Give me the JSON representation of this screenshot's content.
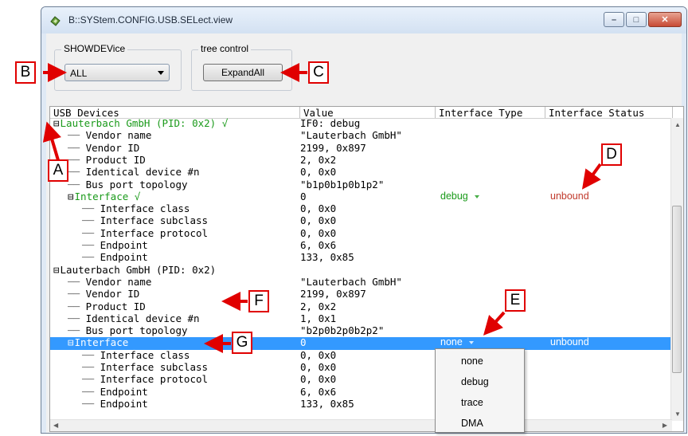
{
  "window": {
    "title": "B::SYStem.CONFIG.USB.SELect.view"
  },
  "controls": {
    "showdevice_label": "SHOWDEVice",
    "showdevice_value": "ALL",
    "tree_control_label": "tree control",
    "expand_button": "ExpandAll"
  },
  "table": {
    "columns": [
      "USB Devices",
      "Value",
      "Interface Type",
      "Interface Status"
    ],
    "rows": [
      {
        "label": "Lauterbach GmbH  (PID: 0x2) √",
        "value": "IF0: debug",
        "type": "",
        "status": ""
      },
      {
        "label": "Vendor name",
        "value": "\"Lauterbach GmbH\"",
        "type": "",
        "status": ""
      },
      {
        "label": "Vendor ID",
        "value": "2199, 0x897",
        "type": "",
        "status": ""
      },
      {
        "label": "Product ID",
        "value": "2, 0x2",
        "type": "",
        "status": ""
      },
      {
        "label": "Identical device #n",
        "value": "0, 0x0",
        "type": "",
        "status": ""
      },
      {
        "label": "Bus port topology",
        "value": "\"b1p0b1p0b1p2\"",
        "type": "",
        "status": ""
      },
      {
        "label": "Interface √",
        "value": "0",
        "type": "debug",
        "status": "unbound"
      },
      {
        "label": "Interface class",
        "value": "0, 0x0",
        "type": "",
        "status": ""
      },
      {
        "label": "Interface subclass",
        "value": "0, 0x0",
        "type": "",
        "status": ""
      },
      {
        "label": "Interface protocol",
        "value": "0, 0x0",
        "type": "",
        "status": ""
      },
      {
        "label": "Endpoint",
        "value": "6, 0x6",
        "type": "",
        "status": ""
      },
      {
        "label": "Endpoint",
        "value": "133, 0x85",
        "type": "",
        "status": ""
      },
      {
        "label": "Lauterbach GmbH  (PID: 0x2)",
        "value": "",
        "type": "",
        "status": ""
      },
      {
        "label": "Vendor name",
        "value": "\"Lauterbach GmbH\"",
        "type": "",
        "status": ""
      },
      {
        "label": "Vendor ID",
        "value": "2199, 0x897",
        "type": "",
        "status": ""
      },
      {
        "label": "Product ID",
        "value": "2, 0x2",
        "type": "",
        "status": ""
      },
      {
        "label": "Identical device #n",
        "value": "1, 0x1",
        "type": "",
        "status": ""
      },
      {
        "label": "Bus port topology",
        "value": "\"b2p0b2p0b2p2\"",
        "type": "",
        "status": ""
      },
      {
        "label": "Interface",
        "value": "0",
        "type": "none",
        "status": "unbound"
      },
      {
        "label": "Interface class",
        "value": "0, 0x0",
        "type": "",
        "status": ""
      },
      {
        "label": "Interface subclass",
        "value": "0, 0x0",
        "type": "",
        "status": ""
      },
      {
        "label": "Interface protocol",
        "value": "0, 0x0",
        "type": "",
        "status": ""
      },
      {
        "label": "Endpoint",
        "value": "6, 0x6",
        "type": "",
        "status": ""
      },
      {
        "label": "Endpoint",
        "value": "133, 0x85",
        "type": "",
        "status": ""
      }
    ]
  },
  "dropdown_options": [
    "none",
    "debug",
    "trace",
    "DMA"
  ],
  "callouts": [
    "A",
    "B",
    "C",
    "D",
    "E",
    "F",
    "G"
  ],
  "colors": {
    "selection": "#3399ff",
    "green": "#1a9a1a",
    "red_status": "#c0392b",
    "callout": "#e00000"
  }
}
